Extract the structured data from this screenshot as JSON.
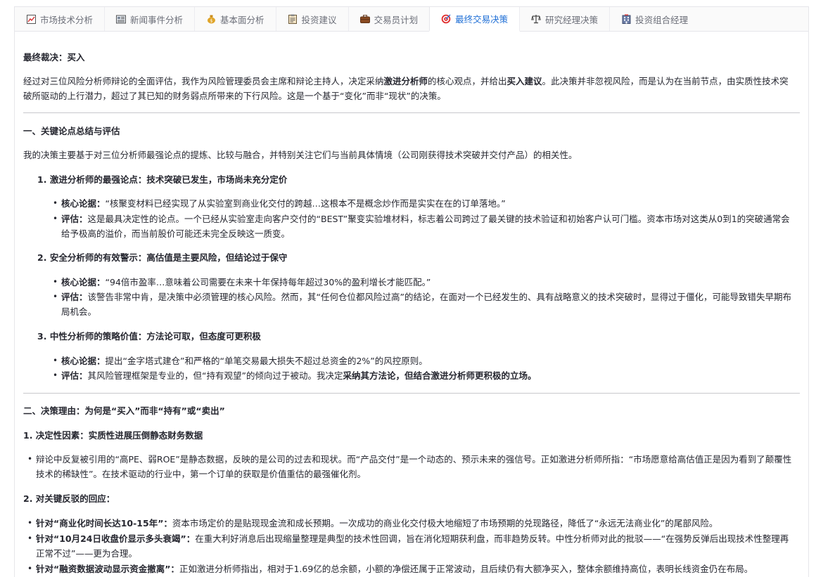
{
  "tabs": [
    {
      "label": "市场技术分析",
      "icon": "chart-icon",
      "active": false
    },
    {
      "label": "新闻事件分析",
      "icon": "newspaper-icon",
      "active": false
    },
    {
      "label": "基本面分析",
      "icon": "money-bag-icon",
      "active": false
    },
    {
      "label": "投资建议",
      "icon": "clipboard-icon",
      "active": false
    },
    {
      "label": "交易员计划",
      "icon": "briefcase-icon",
      "active": false
    },
    {
      "label": "最终交易决策",
      "icon": "target-icon",
      "active": true
    },
    {
      "label": "研究经理决策",
      "icon": "scales-icon",
      "active": false
    },
    {
      "label": "投资组合经理",
      "icon": "building-icon",
      "active": false
    }
  ],
  "verdict": "最终裁决：买入",
  "intro": {
    "a": "经过对三位风险分析师辩论的全面评估，我作为风险管理委员会主席和辩论主持人，决定采纳",
    "b": "激进分析师",
    "c": "的核心观点，并给出",
    "d": "买入建议",
    "e": "。此决策并非忽视风险，而是认为在当前节点，由实质性技术突破所驱动的上行潜力，超过了其已知的财务弱点所带来的下行风险。这是一个基于“变化”而非“现状”的决策。"
  },
  "section1": {
    "title": "一、关键论点总结与评估",
    "desc": "我的决策主要基于对三位分析师最强论点的提炼、比较与融合，并特别关注它们与当前具体情境（公司刚获得技术突破并交付产品）的相关性。",
    "items": [
      {
        "num": "1.",
        "title": "激进分析师的最强论点：技术突破已发生，市场尚未充分定价",
        "core_label": "核心论据：",
        "core": "“核聚变材料已经实现了从实验室到商业化交付的跨越…这根本不是概念炒作而是实实在在的订单落地。”",
        "eval_label": "评估：",
        "eval": "这是最具决定性的论点。一个已经从实验室走向客户交付的“BEST”聚变实验堆材料，标志着公司跨过了最关键的技术验证和初始客户认可门槛。资本市场对这类从0到1的突破通常会给予极高的溢价，而当前股价可能还未完全反映这一质变。"
      },
      {
        "num": "2.",
        "title": "安全分析师的有效警示：高估值是主要风险，但结论过于保守",
        "core_label": "核心论据：",
        "core": "“94倍市盈率…意味着公司需要在未来十年保持每年超过30%的盈利增长才能匹配。”",
        "eval_label": "评估：",
        "eval": "该警告非常中肯，是决策中必须管理的核心风险。然而，其“任何仓位都风险过高”的结论，在面对一个已经发生的、具有战略意义的技术突破时，显得过于僵化，可能导致错失早期布局机会。"
      },
      {
        "num": "3.",
        "title": "中性分析师的策略价值：方法论可取，但态度可更积极",
        "core_label": "核心论据：",
        "core": "提出“金字塔式建仓”和严格的“单笔交易最大损失不超过总资金的2%”的风控原则。",
        "eval_label": "评估：",
        "eval": "其风险管理框架是专业的，但“持有观望”的倾向过于被动。我决定",
        "eval_bold": "采纳其方法论，但结合激进分析师更积极的立场。"
      }
    ]
  },
  "section2": {
    "title": "二、决策理由：为何是“买入”而非“持有”或“卖出”",
    "sub1": "1. 决定性因素：实质性进展压倒静态财务数据",
    "sub1_text": "辩论中反复被引用的“高PE、弱ROE”是静态数据，反映的是公司的过去和现状。而“产品交付”是一个动态的、预示未来的强信号。正如激进分析师所指：“市场愿意给高估值正是因为看到了颠覆性技术的稀缺性”。在技术驱动的行业中，第一个订单的获取是价值重估的最强催化剂。",
    "sub2": "2. 对关键反驳的回应：",
    "rebuttals": [
      {
        "label": "针对“商业化时间长达10-15年”：",
        "text": "资本市场定价的是贴现现金流和成长预期。一次成功的商业化交付极大地缩短了市场预期的兑现路径，降低了“永远无法商业化”的尾部风险。"
      },
      {
        "label": "针对“10月24日收盘价显示多头衰竭”：",
        "text": "在重大利好消息后出现缩量整理是典型的技术性回调，旨在消化短期获利盘，而非趋势反转。中性分析师对此的批驳——“在强势反弹后出现技术性整理再正常不过”——更为合理。"
      },
      {
        "label": "针对“融资数据波动显示资金撤离”：",
        "text": "正如激进分析师指出，相对于1.69亿的总余额，小额的净偿还属于正常波动，且后续仍有大额净买入，整体余额维持高位，表明长线资金仍在布局。"
      }
    ]
  }
}
